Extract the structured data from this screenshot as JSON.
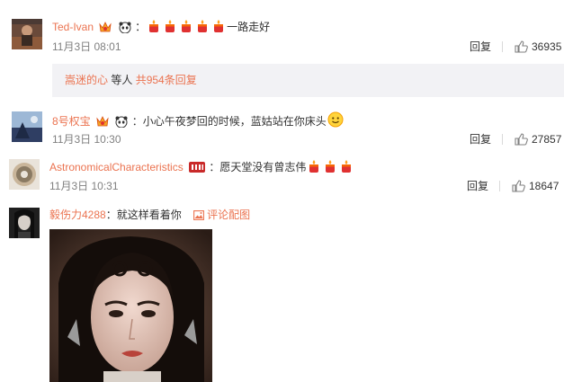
{
  "comments": [
    {
      "username": "Ted-Ivan",
      "colon": "：",
      "text": "一路走好",
      "date": "11月3日 08:01",
      "reply_label": "回复",
      "likes": "36935",
      "emojis": [
        "candle-emoji",
        "candle-emoji",
        "candle-emoji",
        "candle-emoji",
        "candle-emoji"
      ],
      "badges": [
        "crown-badge-icon",
        "panda-badge-icon"
      ],
      "sub_replies": {
        "user": "嵩迷的心",
        "middle": " 等人 ",
        "count_text": "共954条回复"
      }
    },
    {
      "username": "8号权宝",
      "colon": "：",
      "text": "小心午夜梦回的时候，蓝姑站在你床头",
      "date": "11月3日 10:30",
      "reply_label": "回复",
      "likes": "27857",
      "emojis": [
        "smile-emoji"
      ],
      "badges": [
        "crown-badge-icon",
        "panda-badge-icon"
      ]
    },
    {
      "username": "AstronomicalCharacteristics",
      "colon": "：",
      "text": "愿天堂没有曾志伟",
      "date": "11月3日 10:31",
      "reply_label": "回复",
      "likes": "18647",
      "emojis": [
        "candle-emoji",
        "candle-emoji",
        "candle-emoji"
      ],
      "badges": [
        "member-badge-icon"
      ]
    },
    {
      "username": "毅伤力4288",
      "colon": "：",
      "text": "就这样看着你",
      "pic_link": "评论配图"
    }
  ],
  "colors": {
    "username": "#eb7350",
    "meta": "#808080",
    "subbox_bg": "#f2f2f5"
  }
}
